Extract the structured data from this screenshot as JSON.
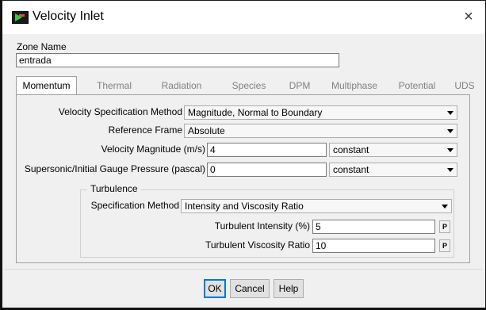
{
  "window": {
    "title": "Velocity Inlet",
    "close_glyph": "×"
  },
  "zone": {
    "label": "Zone Name",
    "value": "entrada"
  },
  "tabs": [
    {
      "label": "Momentum",
      "active": true
    },
    {
      "label": "Thermal"
    },
    {
      "label": "Radiation"
    },
    {
      "label": "Species"
    },
    {
      "label": "DPM"
    },
    {
      "label": "Multiphase"
    },
    {
      "label": "Potential"
    },
    {
      "label": "UDS"
    }
  ],
  "momentum": {
    "vel_spec": {
      "label": "Velocity Specification Method",
      "value": "Magnitude, Normal to Boundary"
    },
    "ref_frame": {
      "label": "Reference Frame",
      "value": "Absolute"
    },
    "vel_mag": {
      "label": "Velocity Magnitude (m/s)",
      "value": "4",
      "method": "constant"
    },
    "gauge_p": {
      "label": "Supersonic/Initial Gauge Pressure (pascal)",
      "value": "0",
      "method": "constant"
    }
  },
  "turbulence": {
    "title": "Turbulence",
    "spec": {
      "label": "Specification Method",
      "value": "Intensity and Viscosity Ratio"
    },
    "intensity": {
      "label": "Turbulent Intensity (%)",
      "value": "5",
      "p": "P"
    },
    "visc_ratio": {
      "label": "Turbulent Viscosity Ratio",
      "value": "10",
      "p": "P"
    }
  },
  "buttons": {
    "ok": "OK",
    "cancel": "Cancel",
    "help": "Help"
  }
}
